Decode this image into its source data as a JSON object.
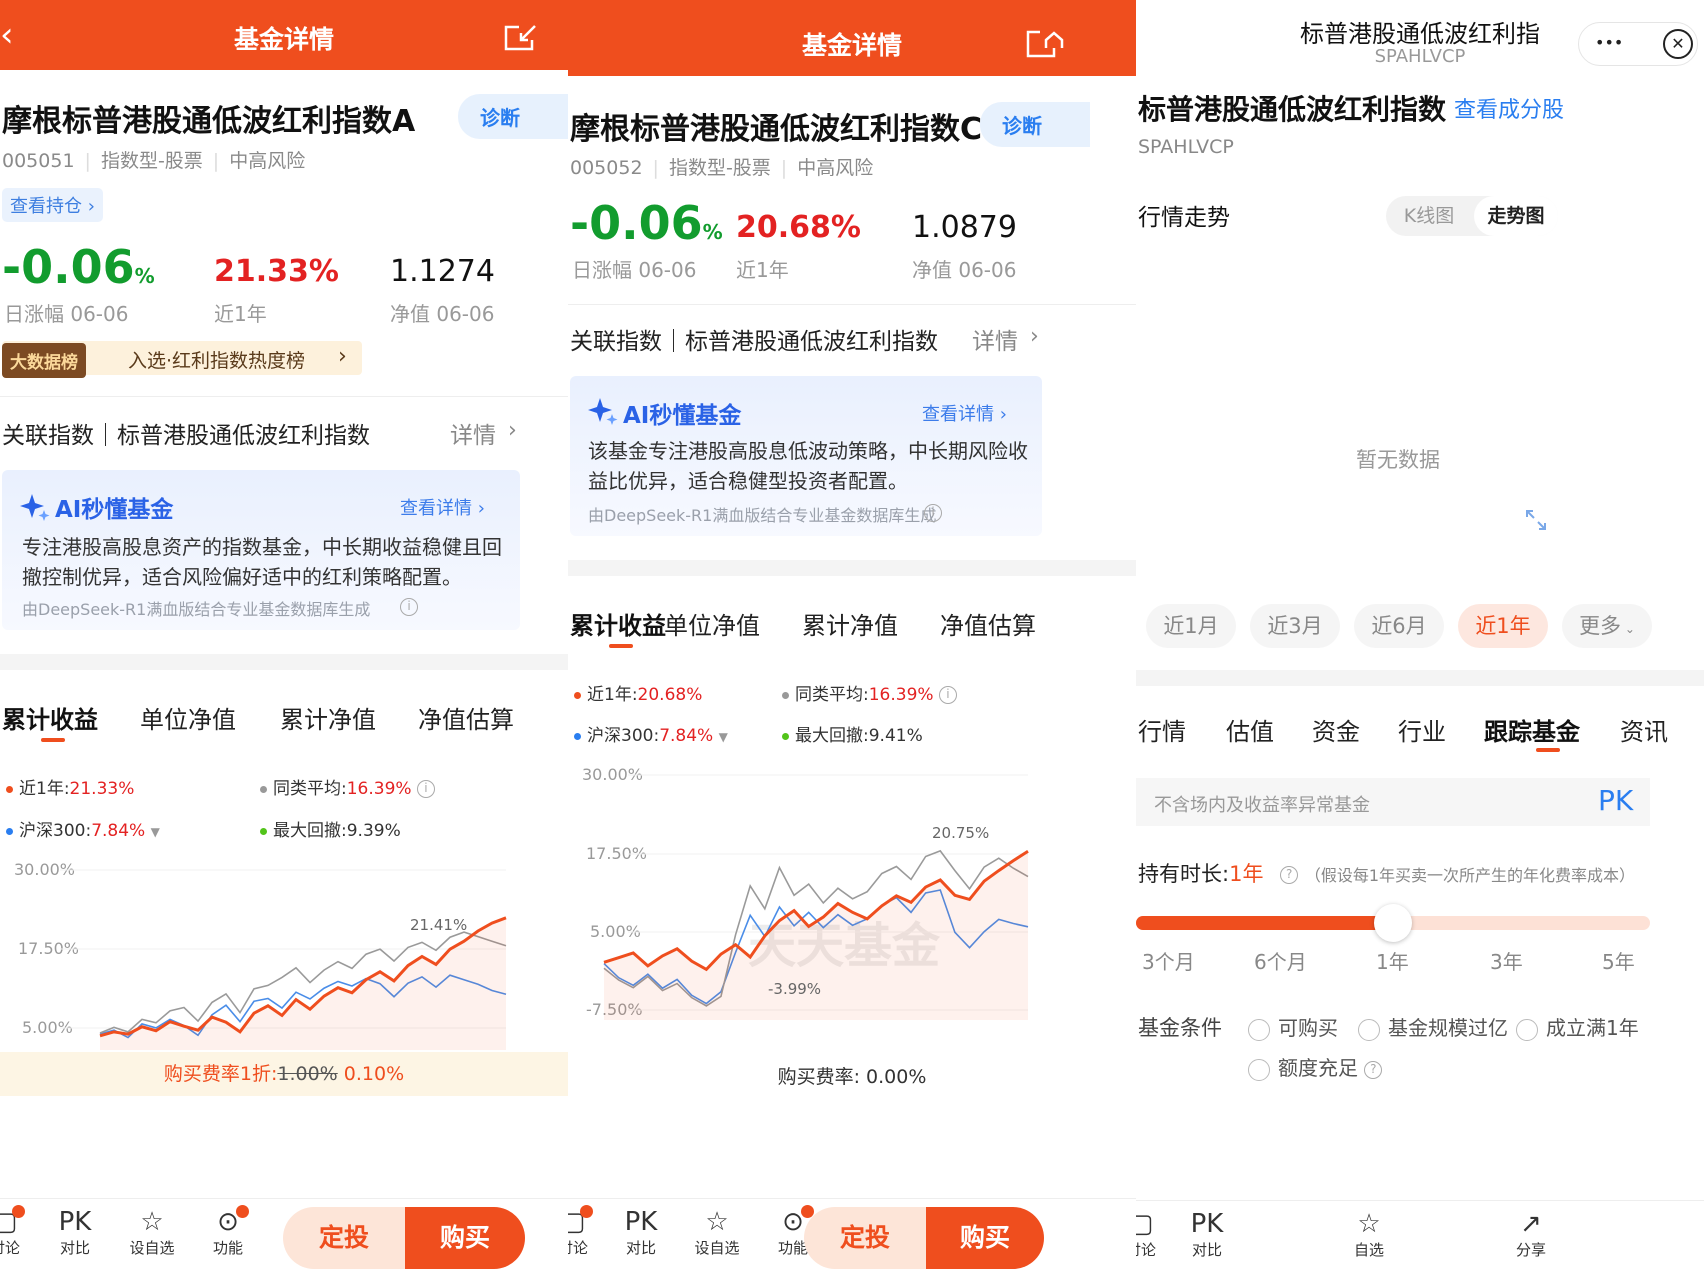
{
  "colors": {
    "brand": "#ef4e1e",
    "green": "#129c2e",
    "red": "#e32222",
    "blue": "#2a7ef0"
  },
  "p1": {
    "header_title": "基金详情",
    "fund_name": "摩根标普港股通低波红利指数A",
    "diagnose": "诊断",
    "code": "005051",
    "type": "指数型-股票",
    "risk": "中高风险",
    "holdings_link": "查看持仓 ›",
    "daily_change": "-0.06",
    "pct": "%",
    "daily_label": "日涨幅 06-06",
    "year_return": "21.33%",
    "year_label": "近1年",
    "nav": "1.1274",
    "nav_label": "净值 06-06",
    "rank_badge": "大数据榜",
    "rank_text": "入选·红利指数热度榜",
    "rank_arrow": "›",
    "index_row": "关联指数｜标普港股通低波红利指数",
    "index_detail": "详情",
    "ai_title": "AI秒懂基金",
    "ai_link": "查看详情 ›",
    "ai_body": "专注港股高股息资产的指数基金，中长期收益稳健且回撤控制优异，适合风险偏好适中的红利策略配置。",
    "ai_source": "由DeepSeek-R1满血版结合专业基金数据库生成",
    "tabs": [
      "累计收益",
      "单位净值",
      "累计净值",
      "净值估算"
    ],
    "legend": [
      {
        "label": "近1年:",
        "value": "21.33%",
        "color": "#ef4e1e"
      },
      {
        "label": "同类平均:",
        "value": "16.39%",
        "color": "#999999"
      },
      {
        "label": "沪深300:",
        "value": "7.84%",
        "color": "#2a7ef0"
      },
      {
        "label": "最大回撤:",
        "value": "9.39%",
        "color": "#52c41a"
      }
    ],
    "yticks": [
      "30.00%",
      "17.50%",
      "5.00%"
    ],
    "peak_label": "21.41%",
    "fee_label": "购买费率1折:",
    "fee_old": "1.00%",
    "fee_new": "0.10%",
    "bottom": [
      "讨论",
      "对比",
      "设自选",
      "功能"
    ],
    "pk": "PK",
    "btn_plan": "定投",
    "btn_buy": "购买"
  },
  "p2": {
    "header_title": "基金详情",
    "fund_name": "摩根标普港股通低波红利指数C",
    "diagnose": "诊断",
    "code": "005052",
    "type": "指数型-股票",
    "risk": "中高风险",
    "daily_change": "-0.06",
    "pct": "%",
    "daily_label": "日涨幅 06-06",
    "year_return": "20.68%",
    "year_label": "近1年",
    "nav": "1.0879",
    "nav_label": "净值 06-06",
    "index_row": "关联指数｜标普港股通低波红利指数",
    "index_detail": "详情",
    "ai_title": "AI秒懂基金",
    "ai_link": "查看详情 ›",
    "ai_body": "该基金专注港股高股息低波动策略，中长期风险收益比优异，适合稳健型投资者配置。",
    "ai_source": "由DeepSeek-R1满血版结合专业基金数据库生成",
    "tabs": [
      "累计收益",
      "单位净值",
      "累计净值",
      "净值估算"
    ],
    "legend": [
      {
        "label": "近1年:",
        "value": "20.68%",
        "color": "#ef4e1e"
      },
      {
        "label": "同类平均:",
        "value": "16.39%",
        "color": "#999999"
      },
      {
        "label": "沪深300:",
        "value": "7.84%",
        "color": "#2a7ef0"
      },
      {
        "label": "最大回撤:",
        "value": "9.41%",
        "color": "#52c41a"
      }
    ],
    "yticks": [
      "30.00%",
      "17.50%",
      "5.00%",
      "-7.50%"
    ],
    "peak_label": "20.75%",
    "trough_label": "-3.99%",
    "watermark": "天天基金",
    "fee_text": "购买费率: 0.00%",
    "bottom": [
      "讨论",
      "对比",
      "设自选",
      "功能"
    ],
    "pk": "PK",
    "btn_plan": "定投",
    "btn_buy": "购买"
  },
  "p3": {
    "title": "标普港股通低波红利指",
    "subtitle": "SPAHLVCP",
    "more": "•••",
    "index_name": "标普港股通低波红利指数",
    "constituents": "查看成分股",
    "code": "SPAHLVCP",
    "trend_title": "行情走势",
    "seg": [
      "K线图",
      "走势图"
    ],
    "no_data": "暂无数据",
    "ranges": [
      "近1月",
      "近3月",
      "近6月",
      "近1年",
      "更多"
    ],
    "tabs": [
      "行情",
      "估值",
      "资金",
      "行业",
      "跟踪基金",
      "资讯"
    ],
    "filter_placeholder": "不含场内及收益率异常基金",
    "pk": "PK",
    "hold_label": "持有时长:",
    "hold_value": "1年",
    "hold_note": "（假设每1年买卖一次所产生的年化费率成本）",
    "slider_ticks": [
      "3个月",
      "6个月",
      "1年",
      "3年",
      "5年"
    ],
    "slider_value_fraction": 0.5,
    "cond_label": "基金条件",
    "conds": [
      "可购买",
      "基金规模过亿",
      "成立满1年",
      "额度充足"
    ],
    "bottom": [
      "讨论",
      "对比",
      "自选",
      "分享"
    ]
  },
  "chart_data": [
    {
      "type": "line",
      "yticks": [
        "30.00%",
        "17.50%",
        "5.00%"
      ],
      "series": [
        {
          "name": "近1年",
          "values": [
            0.5,
            1.2,
            0.8,
            2.1,
            1.4,
            3.0,
            2.2,
            1.5,
            3.8,
            2.9,
            1.2,
            4.5,
            5.8,
            4.1,
            6.9,
            5.2,
            7.5,
            9.0,
            8.1,
            10.4,
            11.8,
            10.2,
            12.9,
            14.5,
            13.1,
            15.8,
            17.2,
            19.0,
            20.4,
            21.33
          ]
        },
        {
          "name": "同类平均",
          "values": [
            1.0,
            2.0,
            1.2,
            3.4,
            2.8,
            4.9,
            5.5,
            3.1,
            6.4,
            7.9,
            4.6,
            8.8,
            9.4,
            10.8,
            12.5,
            9.9,
            12.1,
            13.6,
            12.4,
            14.9,
            15.8,
            13.7,
            16.1,
            17.0,
            15.6,
            17.9,
            18.8,
            18.0,
            17.2,
            16.39
          ]
        },
        {
          "name": "沪深300",
          "values": [
            0.8,
            1.5,
            0.2,
            2.6,
            1.9,
            3.4,
            2.3,
            0.6,
            4.2,
            5.9,
            3.0,
            6.6,
            7.1,
            5.4,
            8.2,
            7.0,
            8.9,
            10.1,
            9.3,
            10.6,
            9.7,
            7.4,
            9.8,
            10.9,
            9.1,
            11.2,
            10.4,
            9.6,
            8.5,
            7.84
          ]
        }
      ]
    },
    {
      "type": "line",
      "yticks": [
        "30.00%",
        "17.50%",
        "5.00%",
        "-7.50%"
      ],
      "series": [
        {
          "name": "近1年",
          "values": [
            1.8,
            2.6,
            3.4,
            1.2,
            2.9,
            4.1,
            2.0,
            0.6,
            3.2,
            4.8,
            2.7,
            6.3,
            8.9,
            10.6,
            7.9,
            9.5,
            11.8,
            10.3,
            9.2,
            11.4,
            13.1,
            12.0,
            14.6,
            15.8,
            13.2,
            12.5,
            15.6,
            17.4,
            19.1,
            20.68
          ]
        },
        {
          "name": "同类平均",
          "values": [
            0.8,
            -1.2,
            -2.5,
            -0.6,
            -3.0,
            -1.8,
            -4.2,
            -5.6,
            -3.99,
            6.5,
            14.8,
            10.9,
            17.9,
            13.2,
            15.1,
            11.9,
            14.4,
            12.6,
            13.8,
            16.9,
            18.1,
            15.9,
            19.8,
            20.75,
            17.4,
            14.3,
            18.0,
            19.5,
            17.8,
            16.39
          ]
        },
        {
          "name": "沪深300",
          "values": [
            1.6,
            -0.8,
            -2.1,
            -0.2,
            -2.6,
            -1.1,
            -3.8,
            -5.2,
            -3.2,
            3.5,
            9.8,
            6.2,
            11.2,
            8.0,
            10.3,
            7.7,
            9.9,
            8.1,
            9.2,
            11.5,
            12.8,
            10.3,
            13.6,
            14.1,
            6.9,
            4.3,
            7.0,
            9.1,
            8.4,
            7.84
          ]
        }
      ]
    }
  ]
}
